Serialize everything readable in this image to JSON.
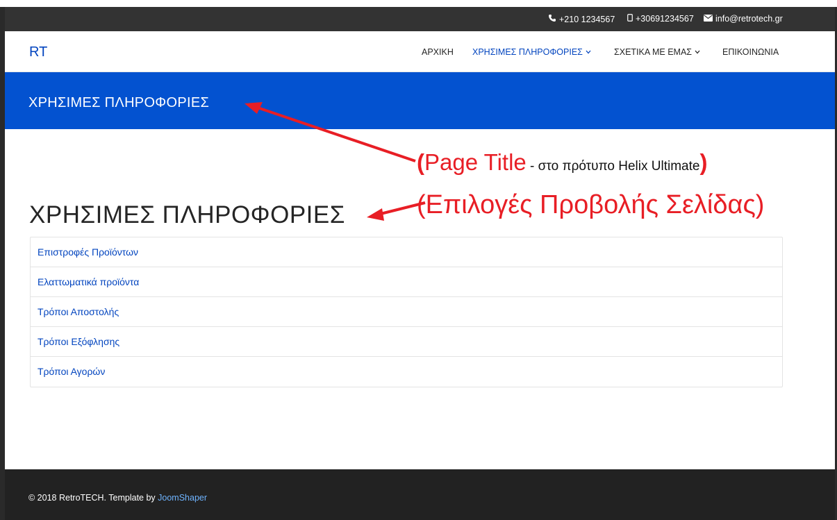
{
  "topbar": {
    "phone": "+210 1234567",
    "mobile": "+30691234567",
    "email": "info@retrotech.gr",
    "icons": [
      "phone-icon",
      "mobile-icon",
      "envelope-icon"
    ]
  },
  "navbar": {
    "logo": "RT",
    "menu": [
      {
        "label": "ΑΡΧΙΚΗ",
        "dropdown": false,
        "active": false
      },
      {
        "label": "ΧΡΗΣΙΜΕΣ ΠΛΗΡΟΦΟΡΙΕΣ",
        "dropdown": true,
        "active": true
      },
      {
        "label": "ΣΧΕΤΙΚΑ ΜΕ ΕΜΑΣ",
        "dropdown": true,
        "active": false
      },
      {
        "label": "ΕΠΙΚΟΙΝΩΝΙΑ",
        "dropdown": false,
        "active": false
      }
    ]
  },
  "page_title_bar": {
    "title": "ΧΡΗΣΙΜΕΣ ΠΛΗΡΟΦΟΡΙΕΣ"
  },
  "annotations": {
    "line1_open": "(",
    "line1_main": "Page Title",
    "line1_small": " - στο πρότυπο Helix Ultimate",
    "line1_close": ")",
    "line2": "(Επιλογές Προβολής Σελίδας)"
  },
  "main": {
    "heading": "ΧΡΗΣΙΜΕΣ ΠΛΗΡΟΦΟΡΙΕΣ",
    "items": [
      "Επιστροφές Προϊόντων",
      "Ελαττωματικά προϊόντα",
      "Τρόποι Αποστολής",
      "Τρόποι Εξόφλησης",
      "Τρόποι Αγορών"
    ]
  },
  "footer": {
    "text": "© 2018 RetroTECH. Template by ",
    "link": "JoomShaper"
  },
  "colors": {
    "brand_blue": "#0352d0",
    "link_blue": "#0345bf",
    "annotation_red": "#e81e25",
    "topbar_bg": "#333333",
    "footer_bg": "#222222"
  }
}
